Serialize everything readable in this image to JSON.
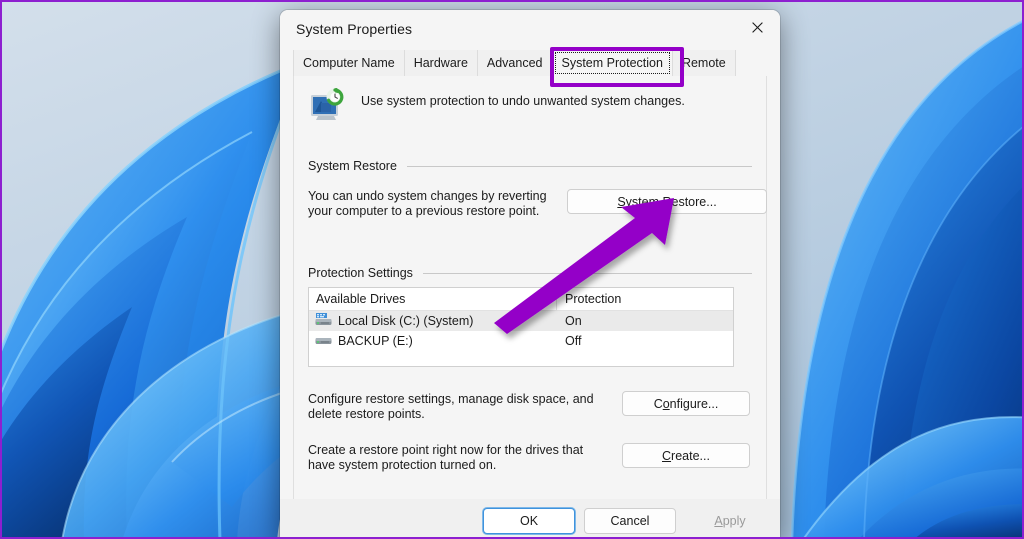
{
  "window": {
    "title": "System Properties",
    "close_icon": "close-icon"
  },
  "tabs": [
    {
      "label": "Computer Name",
      "selected": false
    },
    {
      "label": "Hardware",
      "selected": false
    },
    {
      "label": "Advanced",
      "selected": false
    },
    {
      "label": "System Protection",
      "selected": true
    },
    {
      "label": "Remote",
      "selected": false
    }
  ],
  "intro": {
    "icon": "system-protection-icon",
    "text": "Use system protection to undo unwanted system changes."
  },
  "system_restore": {
    "group_label": "System Restore",
    "description_line1": "You can undo system changes by reverting",
    "description_line2": "your computer to a previous restore point.",
    "button_label": "System Restore...",
    "button_accel": "S"
  },
  "protection_settings": {
    "group_label": "Protection Settings",
    "columns": [
      "Available Drives",
      "Protection"
    ],
    "rows": [
      {
        "drive": "Local Disk (C:) (System)",
        "protection": "On",
        "icon": "system-drive-icon",
        "selected": true
      },
      {
        "drive": "BACKUP (E:)",
        "protection": "Off",
        "icon": "drive-icon",
        "selected": false
      }
    ],
    "configure_line1": "Configure restore settings, manage disk space, and",
    "configure_line2": "delete restore points.",
    "configure_button_label": "Configure...",
    "configure_button_accel": "o",
    "create_line1": "Create a restore point right now for the drives that",
    "create_line2": "have system protection turned on.",
    "create_button_label": "Create...",
    "create_button_accel": "C"
  },
  "footer": {
    "ok_label": "OK",
    "cancel_label": "Cancel",
    "apply_label": "Apply",
    "apply_accel": "A",
    "apply_disabled": true
  },
  "annotations": {
    "highlight_color": "#9400c8",
    "arrow_color": "#9400c8",
    "arrow_name": "purple-arrow-pointing-to-system-restore-button"
  }
}
